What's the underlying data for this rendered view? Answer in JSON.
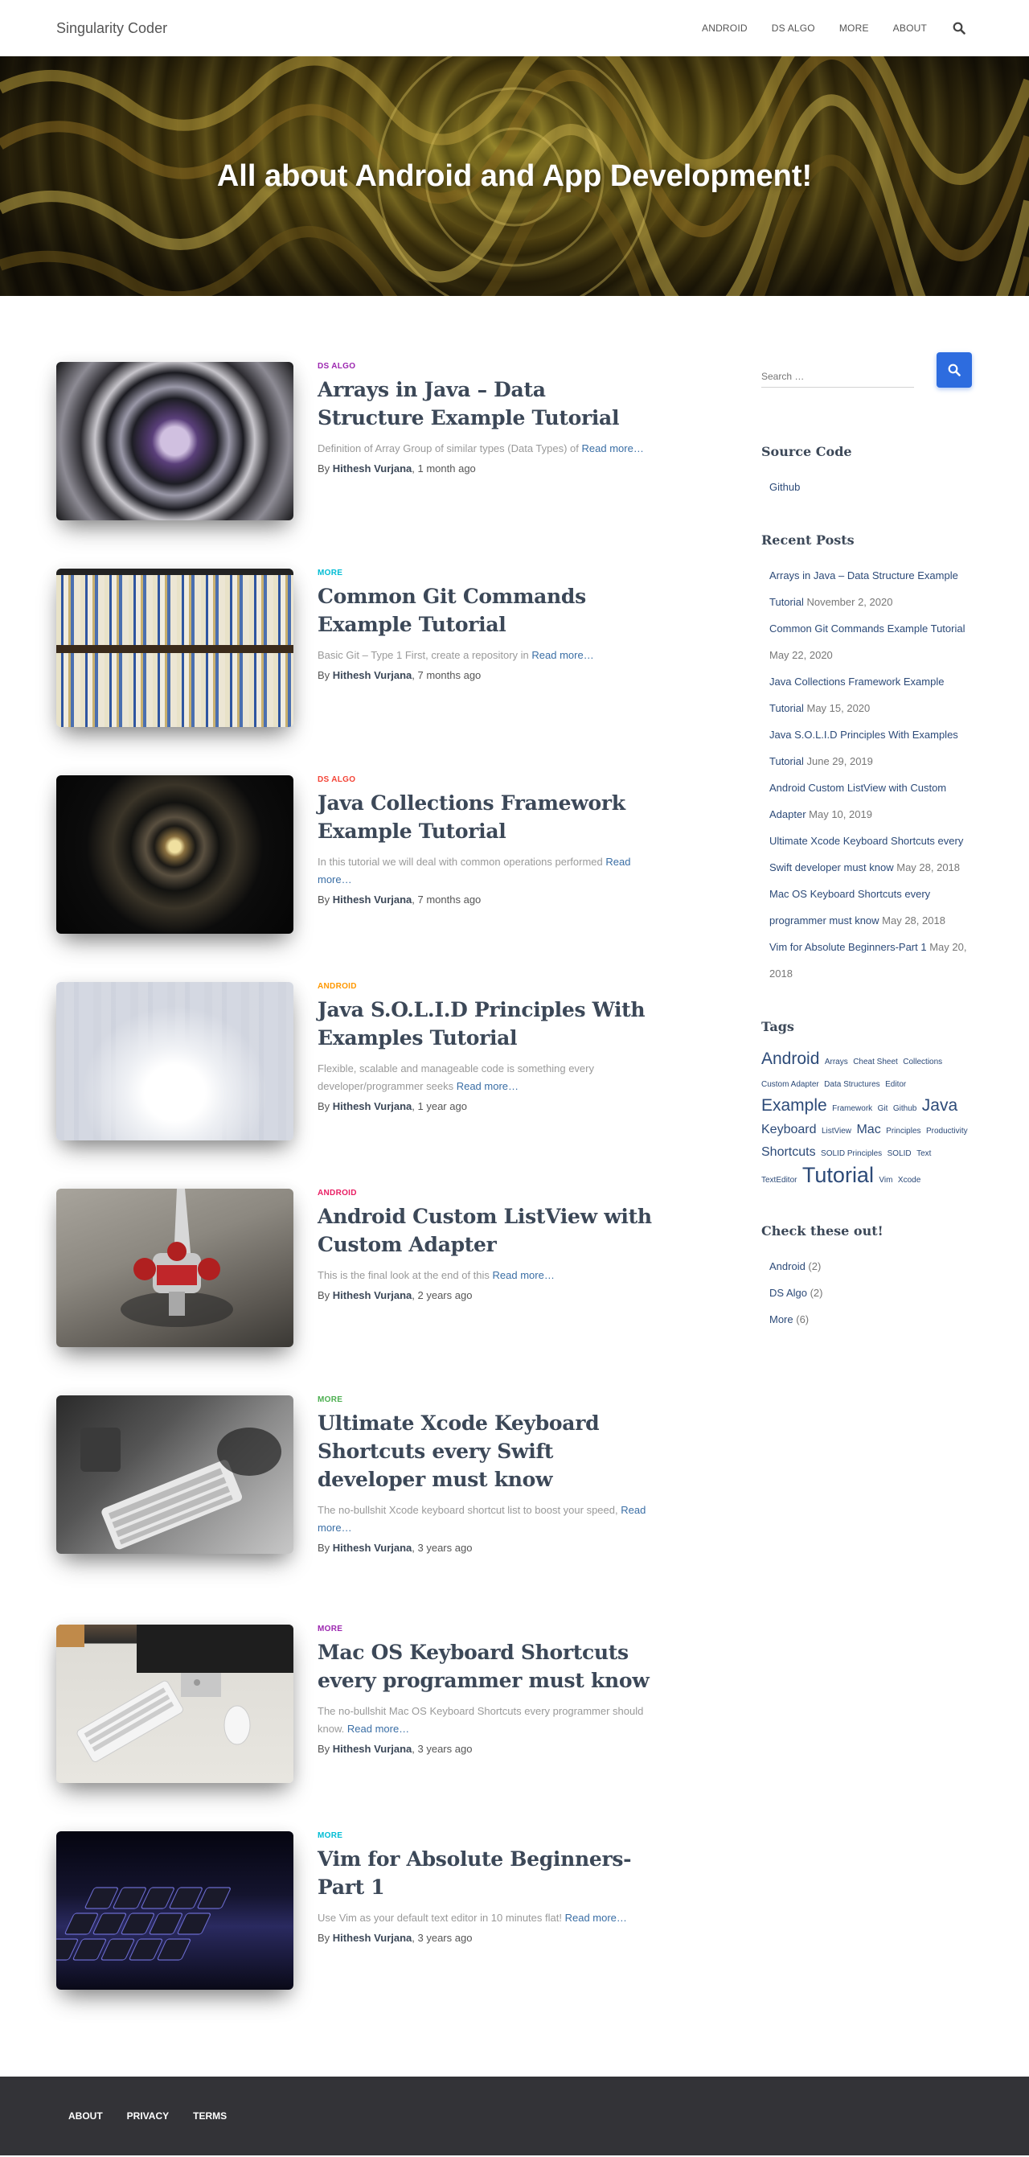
{
  "navbar": {
    "brand": "Singularity Coder",
    "links": [
      "ANDROID",
      "DS ALGO",
      "MORE",
      "ABOUT"
    ],
    "search_icon": "search-icon"
  },
  "hero": {
    "title": "All about Android and App Development!"
  },
  "posts": [
    {
      "category": "DS ALGO",
      "category_color": "#9c27b0",
      "title": "Arrays in Java – Data Structure Example Tutorial",
      "excerpt": "Definition of Array Group of similar types (Data Types) of",
      "read_more": "Read more…",
      "by": "By",
      "author": "Hithesh Vurjana",
      "ago": ", 1 month ago"
    },
    {
      "category": "MORE",
      "category_color": "#00bcd4",
      "title": "Common Git Commands Example Tutorial",
      "excerpt": "Basic Git – Type 1 First, create a repository in",
      "read_more": "Read more…",
      "by": "By",
      "author": "Hithesh Vurjana",
      "ago": ", 7 months ago"
    },
    {
      "category": "DS ALGO",
      "category_color": "#f44336",
      "title": "Java Collections Framework Example Tutorial",
      "excerpt": "In this tutorial we will deal with common operations performed",
      "read_more": "Read more…",
      "by": "By",
      "author": "Hithesh Vurjana",
      "ago": ", 7 months ago"
    },
    {
      "category": "ANDROID",
      "category_color": "#ff9800",
      "title": "Java S.O.L.I.D Principles With Examples Tutorial",
      "excerpt": "Flexible, scalable and manageable code is something every developer/programmer seeks",
      "read_more": "Read more…",
      "by": "By",
      "author": "Hithesh Vurjana",
      "ago": ", 1 year ago"
    },
    {
      "category": "ANDROID",
      "category_color": "#e91e63",
      "title": "Android Custom ListView with Custom Adapter",
      "excerpt": "This is the final look at the end of this",
      "read_more": "Read more…",
      "by": "By",
      "author": "Hithesh Vurjana",
      "ago": ", 2 years ago"
    },
    {
      "category": "MORE",
      "category_color": "#4caf50",
      "title": "Ultimate Xcode Keyboard Shortcuts every Swift developer must know",
      "excerpt": "The no-bullshit Xcode keyboard shortcut list to boost your speed,",
      "read_more": "Read more…",
      "by": "By",
      "author": "Hithesh Vurjana",
      "ago": ", 3 years ago"
    },
    {
      "category": "MORE",
      "category_color": "#9c27b0",
      "title": "Mac OS Keyboard Shortcuts every programmer must know",
      "excerpt": "The no-bullshit Mac OS Keyboard Shortcuts every programmer should know.",
      "read_more": "Read more…",
      "by": "By",
      "author": "Hithesh Vurjana",
      "ago": ", 3 years ago"
    },
    {
      "category": "MORE",
      "category_color": "#00bcd4",
      "title": "Vim for Absolute Beginners-Part 1",
      "excerpt": "Use Vim as your default text editor in 10 minutes flat!",
      "read_more": "Read more…",
      "by": "By",
      "author": "Hithesh Vurjana",
      "ago": ", 3 years ago"
    }
  ],
  "sidebar": {
    "search_placeholder": "Search …",
    "source_code": {
      "title": "Source Code",
      "items": [
        "Github"
      ]
    },
    "recent_posts": {
      "title": "Recent Posts",
      "items": [
        {
          "title": "Arrays in Java – Data Structure Example Tutorial",
          "date": " November 2, 2020"
        },
        {
          "title": "Common Git Commands Example Tutorial",
          "date": " May 22, 2020"
        },
        {
          "title": "Java Collections Framework Example Tutorial",
          "date": " May 15, 2020"
        },
        {
          "title": "Java S.O.L.I.D Principles With Examples Tutorial",
          "date": " June 29, 2019"
        },
        {
          "title": "Android Custom ListView with Custom Adapter",
          "date": " May 10, 2019"
        },
        {
          "title": "Ultimate Xcode Keyboard Shortcuts every Swift developer must know",
          "date": " May 28, 2018"
        },
        {
          "title": "Mac OS Keyboard Shortcuts every programmer must know",
          "date": " May 28, 2018"
        },
        {
          "title": "Vim for Absolute Beginners-Part 1",
          "date": " May 20, 2018"
        }
      ]
    },
    "tags": {
      "title": "Tags",
      "items": [
        "Android",
        "Arrays",
        "Cheat Sheet",
        "Collections",
        "Custom Adapter",
        "Data Structures",
        "Editor",
        "Example",
        "Framework",
        "Git",
        "Github",
        "Java",
        "Keyboard",
        "ListView",
        "Mac",
        "Principles",
        "Productivity",
        "Shortcuts",
        "SOLID Principles",
        "SOLID",
        "Text",
        "TextEditor",
        "Tutorial",
        "Vim",
        "Xcode"
      ]
    },
    "check_out": {
      "title": "Check these out!",
      "items": [
        {
          "name": "Android",
          "count": " (2)"
        },
        {
          "name": "DS Algo",
          "count": " (2)"
        },
        {
          "name": "More",
          "count": " (6)"
        }
      ]
    }
  },
  "footer": {
    "links": [
      "ABOUT",
      "PRIVACY",
      "TERMS"
    ]
  }
}
